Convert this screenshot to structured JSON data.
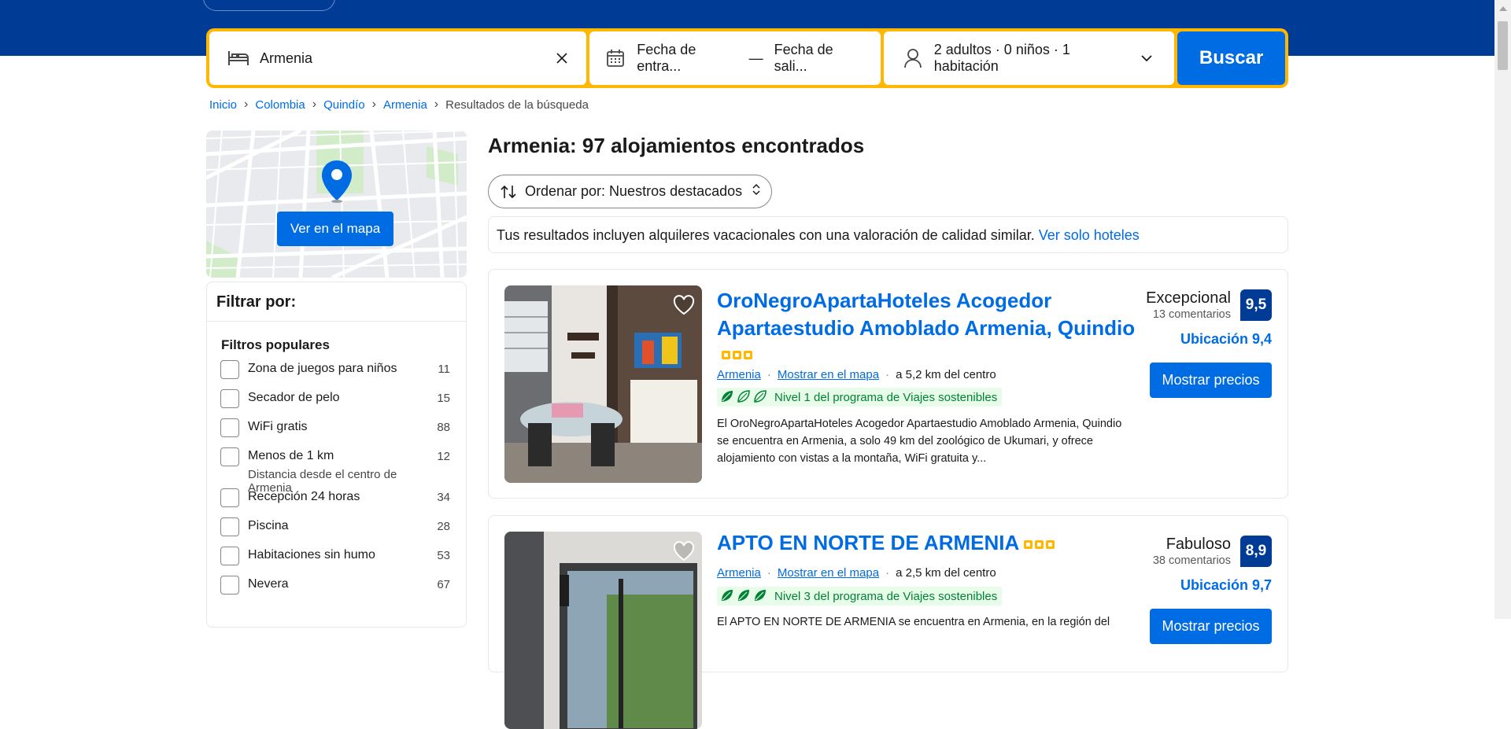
{
  "search": {
    "destination": "Armenia",
    "checkin": "Fecha de entra...",
    "checkout": "Fecha de sali...",
    "dash": "—",
    "guests": "2 adultos · 0 niños · 1 habitación",
    "submit_label": "Buscar"
  },
  "breadcrumb": {
    "items": [
      "Inicio",
      "Colombia",
      "Quindío",
      "Armenia"
    ],
    "current": "Resultados de la búsqueda"
  },
  "map": {
    "button_label": "Ver en el mapa"
  },
  "filters": {
    "heading": "Filtrar por:",
    "section_title": "Filtros populares",
    "items": [
      {
        "label": "Zona de juegos para niños",
        "count": "11"
      },
      {
        "label": "Secador de pelo",
        "count": "15"
      },
      {
        "label": "WiFi gratis",
        "count": "88"
      },
      {
        "label": "Menos de 1 km",
        "note": "Distancia desde el centro de Armenia",
        "count": "12"
      },
      {
        "label": "Recepción 24 horas",
        "count": "34"
      },
      {
        "label": "Piscina",
        "count": "28"
      },
      {
        "label": "Habitaciones sin humo",
        "count": "53"
      },
      {
        "label": "Nevera",
        "count": "67"
      }
    ]
  },
  "results": {
    "title": "Armenia: 97 alojamientos encontrados",
    "sort_label": "Ordenar por: Nuestros destacados",
    "info_text": "Tus resultados incluyen alquileres vacacionales con una valoración de calidad similar. ",
    "info_link": "Ver solo hoteles"
  },
  "properties": [
    {
      "name": "OroNegroApartaHoteles Acogedor Apartaestudio Amoblado Armenia, Quindio",
      "stars": 3,
      "city": "Armenia",
      "map_link": "Mostrar en el mapa",
      "distance": "a 5,2 km del centro",
      "eco_level": "Nivel 1 del programa de Viajes sostenibles",
      "eco_leaves_filled": 1,
      "description": "El OroNegroApartaHoteles Acogedor Apartaestudio Amoblado Armenia, Quindio se encuentra en Armenia, a solo 49 km del zoológico de Ukumari, y ofrece alojamiento con vistas a la montaña, WiFi gratuita y...",
      "score_word": "Excepcional",
      "reviews": "13 comentarios",
      "score": "9,5",
      "location_score": "Ubicación 9,4",
      "cta": "Mostrar precios"
    },
    {
      "name": "APTO EN NORTE DE ARMENIA",
      "stars": 3,
      "city": "Armenia",
      "map_link": "Mostrar en el mapa",
      "distance": "a 2,5 km del centro",
      "eco_level": "Nivel 3 del programa de Viajes sostenibles",
      "eco_leaves_filled": 3,
      "description": "El APTO EN NORTE DE ARMENIA se encuentra en Armenia, en la región del",
      "score_word": "Fabuloso",
      "reviews": "38 comentarios",
      "score": "8,9",
      "location_score": "Ubicación 9,7",
      "cta": "Mostrar precios"
    }
  ],
  "colors": {
    "brand_dark": "#003b95",
    "brand_blue": "#006ce4",
    "search_border": "#ffb700",
    "eco_green": "#008234"
  }
}
